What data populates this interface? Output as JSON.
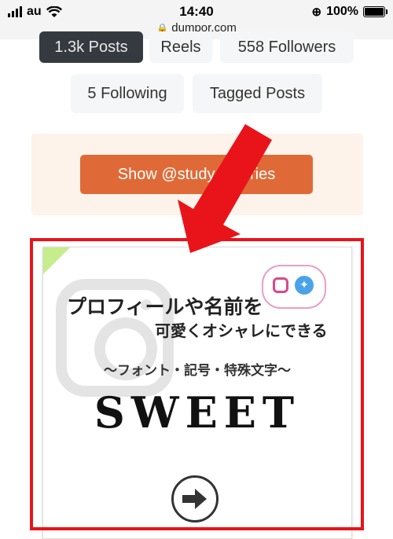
{
  "status_bar": {
    "carrier": "au",
    "time": "14:40",
    "url": "dumpor.com",
    "battery": "100%"
  },
  "profile_stats": {
    "posts": "1.3k Posts",
    "reels": "Reels",
    "followers": "558 Followers",
    "following": "5 Following",
    "tagged": "Tagged Posts"
  },
  "promo": {
    "show_stories_label": "Show @study_a    tories"
  },
  "ad": {
    "title_line1": "プロフィールや名前を",
    "title_line2": "可愛くオシャレにできる",
    "subtitle": "〜フォント・記号・特殊文字〜",
    "logo_text": "SWEET"
  },
  "colors": {
    "annotation_red": "#e8141a",
    "button_orange": "#e06a37",
    "dark_pill": "#343a40"
  }
}
